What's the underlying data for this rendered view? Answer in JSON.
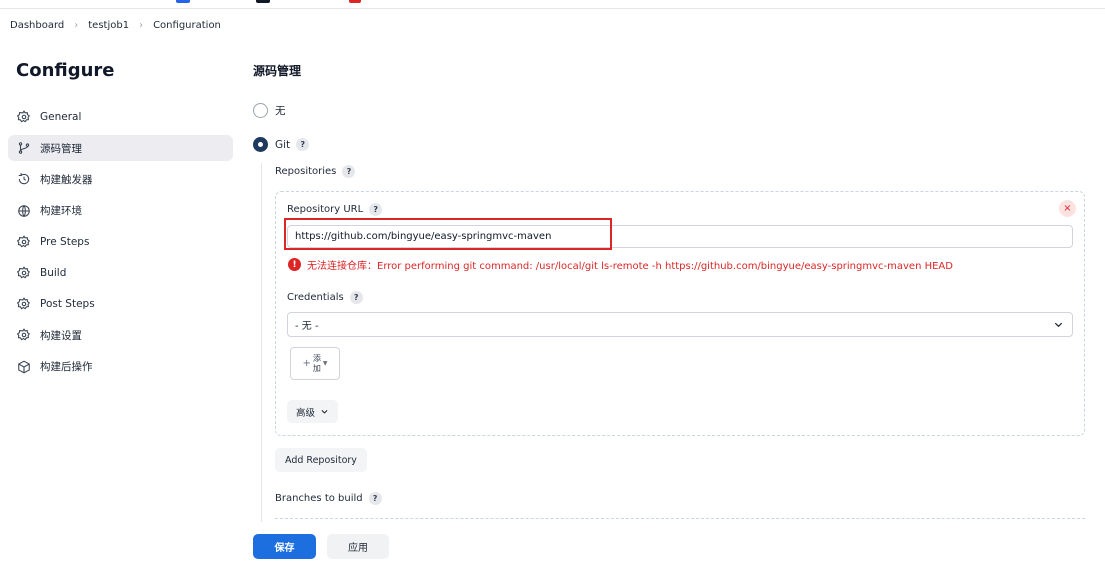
{
  "breadcrumb": {
    "items": [
      "Dashboard",
      "testjob1",
      "Configuration"
    ]
  },
  "sidebar": {
    "title": "Configure",
    "items": [
      {
        "label": "General",
        "icon": "gear-icon"
      },
      {
        "label": "源码管理",
        "icon": "branch-icon",
        "active": true
      },
      {
        "label": "构建触发器",
        "icon": "clock-icon"
      },
      {
        "label": "构建环境",
        "icon": "globe-icon"
      },
      {
        "label": "Pre Steps",
        "icon": "gear-icon"
      },
      {
        "label": "Build",
        "icon": "gear-icon"
      },
      {
        "label": "Post Steps",
        "icon": "gear-icon"
      },
      {
        "label": "构建设置",
        "icon": "gear-icon"
      },
      {
        "label": "构建后操作",
        "icon": "cube-icon"
      }
    ]
  },
  "scm": {
    "title": "源码管理",
    "option_none": "无",
    "option_git": "Git",
    "repositories_label": "Repositories",
    "repo_url_label": "Repository URL",
    "repo_url_value": "https://github.com/bingyue/easy-springmvc-maven",
    "error_text": "无法连接仓库：Error performing git command: /usr/local/git ls-remote -h https://github.com/bingyue/easy-springmvc-maven HEAD",
    "credentials_label": "Credentials",
    "credentials_value": "- 无 -",
    "add_label": "添加",
    "advanced_label": "高级",
    "add_repository_label": "Add Repository",
    "branches_label": "Branches to build",
    "help_glyph": "?",
    "close_glyph": "×",
    "error_glyph": "!"
  },
  "footer": {
    "save_label": "保存",
    "apply_label": "应用"
  },
  "colors": {
    "primary": "#1d6fe0",
    "error": "#dc2626",
    "radio_checked": "#1e3a5f",
    "active_nav": "#ececf1"
  }
}
